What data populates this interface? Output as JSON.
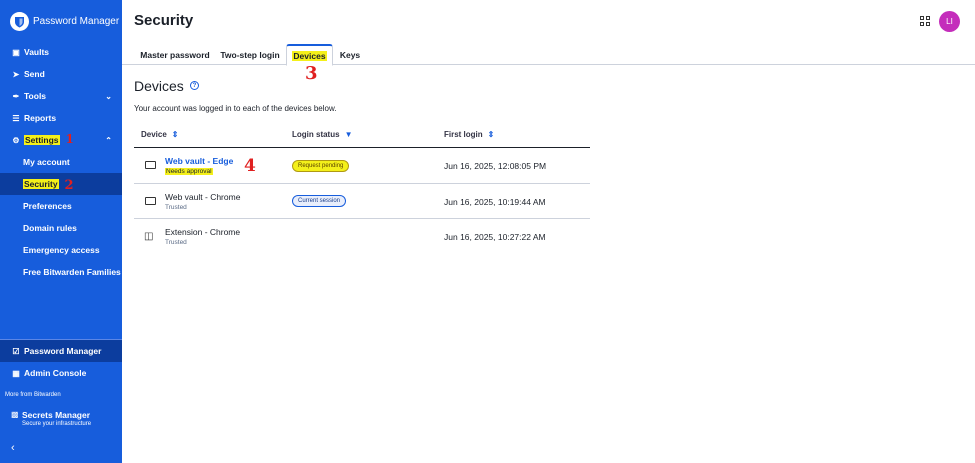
{
  "sidebar": {
    "brand": "Password Manager",
    "nav": [
      {
        "label": "Vaults",
        "icon": "vault-icon"
      },
      {
        "label": "Send",
        "icon": "send-icon"
      },
      {
        "label": "Tools",
        "icon": "wrench-icon"
      },
      {
        "label": "Reports",
        "icon": "reports-icon"
      },
      {
        "label": "Settings",
        "icon": "gear-icon"
      }
    ],
    "settings_sub": [
      {
        "label": "My account"
      },
      {
        "label": "Security"
      },
      {
        "label": "Preferences"
      },
      {
        "label": "Domain rules"
      },
      {
        "label": "Emergency access"
      },
      {
        "label": "Free Bitwarden Families"
      }
    ],
    "products": [
      {
        "label": "Password Manager"
      },
      {
        "label": "Admin Console"
      }
    ],
    "more_label": "More from Bitwarden",
    "secrets_manager": {
      "title": "Secrets Manager",
      "subtitle": "Secure your infrastructure"
    }
  },
  "header": {
    "title": "Security",
    "avatar_initials": "LI",
    "avatar_color": "#c42dbb"
  },
  "tabs": [
    {
      "label": "Master password"
    },
    {
      "label": "Two-step login"
    },
    {
      "label": "Devices"
    },
    {
      "label": "Keys"
    }
  ],
  "annotations": {
    "a1": "1",
    "a2": "2",
    "a3": "3",
    "a4": "4"
  },
  "devices": {
    "title": "Devices",
    "description": "Your account was logged in to each of the devices below.",
    "columns": {
      "device": "Device",
      "status": "Login status",
      "first_login": "First login"
    },
    "rows": [
      {
        "name": "Web vault - Edge",
        "sub": "Needs approval",
        "status": "Request pending",
        "first_login": "Jun 16, 2025, 12:08:05 PM"
      },
      {
        "name": "Web vault - Chrome",
        "sub": "Trusted",
        "status": "Current session",
        "first_login": "Jun 16, 2025, 10:19:44 AM"
      },
      {
        "name": "Extension - Chrome",
        "sub": "Trusted",
        "status": "",
        "first_login": "Jun 16, 2025, 10:27:22 AM"
      }
    ]
  },
  "colors": {
    "brand": "#175ddc",
    "highlight": "#f4f01a",
    "annotation": "#e02020"
  }
}
